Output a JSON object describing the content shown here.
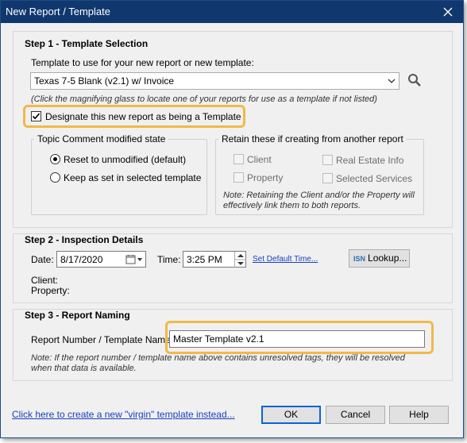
{
  "window": {
    "title": "New Report / Template"
  },
  "step1": {
    "title": "Step 1 - Template Selection",
    "template_label": "Template to use for your new report or new template:",
    "template_value": "Texas 7-5 Blank (v2.1) w/ Invoice",
    "hint": "(Click the magnifying glass to locate one of your reports for use as a template if not listed)",
    "designate_label": "Designate this new report as being a Template",
    "designate_checked": true,
    "topic_group": {
      "title": "Topic Comment modified state",
      "options": [
        "Reset to unmodified (default)",
        "Keep as set in selected template"
      ],
      "selected": 0
    },
    "retain_group": {
      "title": "Retain these if creating from another report",
      "items": [
        "Client",
        "Real Estate Info",
        "Property",
        "Selected Services"
      ],
      "note": "Note: Retaining the Client and/or the Property will effectively link them to both reports."
    }
  },
  "step2": {
    "title": "Step 2 - Inspection Details",
    "date_label": "Date:",
    "date_value": "8/17/2020",
    "time_label": "Time:",
    "time_value": "3:25 PM",
    "default_time_link": "Set Default Time...",
    "lookup_badge": "ISN",
    "lookup_label": "Lookup...",
    "client_label": "Client:",
    "property_label": "Property:"
  },
  "step3": {
    "title": "Step 3 - Report Naming",
    "name_label": "Report Number / Template Name:",
    "name_value": "Master Template v2.1",
    "note": "Note: If the report number / template name above contains unresolved tags, they will be resolved when that data is available."
  },
  "footer": {
    "virgin_link": "Click here to create a new \"virgin\" template instead...",
    "ok": "OK",
    "cancel": "Cancel",
    "help": "Help"
  },
  "colors": {
    "titlebar": "#10386f",
    "highlight": "#f0b94a",
    "link": "#1a3fbf"
  },
  "icons": [
    "close-icon",
    "search-icon",
    "chevron-down-icon",
    "calendar-icon",
    "check-icon",
    "spin-up-icon",
    "spin-down-icon"
  ]
}
